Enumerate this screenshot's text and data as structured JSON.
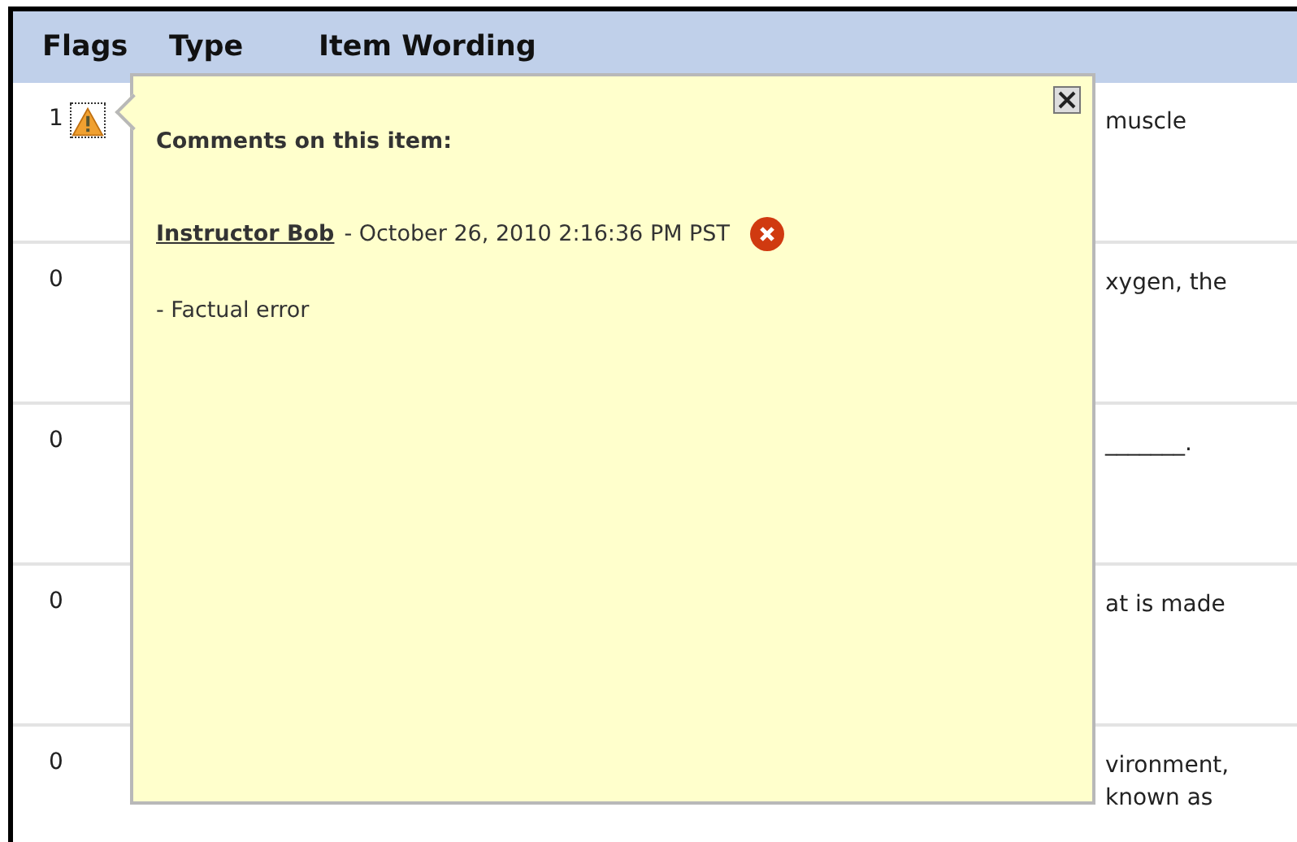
{
  "table": {
    "columns": [
      "Flags",
      "Type",
      "Item Wording"
    ],
    "rows": [
      {
        "flags": "1",
        "flagged": true,
        "wording": [
          "muscle"
        ]
      },
      {
        "flags": "0",
        "flagged": false,
        "wording": [
          "xygen, the"
        ]
      },
      {
        "flags": "0",
        "flagged": false,
        "wording": [
          "_______."
        ]
      },
      {
        "flags": "0",
        "flagged": false,
        "wording": [
          "at is made"
        ]
      },
      {
        "flags": "0",
        "flagged": false,
        "wording": [
          "vironment,",
          "known as"
        ]
      }
    ]
  },
  "popup": {
    "title": "Comments on this item:",
    "comments": [
      {
        "author": "Instructor Bob",
        "date": "- October 26, 2010 2:16:36 PM PST",
        "text": "- Factual error"
      }
    ]
  }
}
